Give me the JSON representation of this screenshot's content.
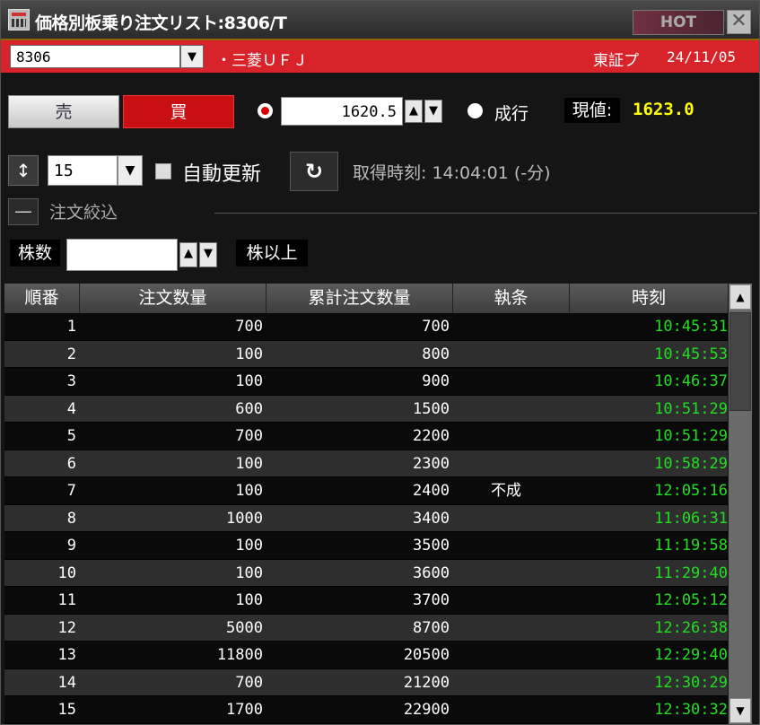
{
  "window": {
    "title": "価格別板乗り注文リスト:8306/T",
    "hot_label": "HOT",
    "close_label": "✕"
  },
  "symbol": {
    "code": "8306",
    "name": "・三菱ＵＦＪ",
    "market": "東証プ",
    "date": "24/11/05"
  },
  "order": {
    "sell_label": "売",
    "buy_label": "買",
    "price": "1620.5",
    "market_label": "成行",
    "current_label": "現値:",
    "current_value": "1623.0"
  },
  "controls": {
    "sort_icon": "↕",
    "row_count": "15",
    "auto_refresh_label": "自動更新",
    "refresh_icon": "↻",
    "fetch_time": "取得時刻: 14:04:01 (-分)",
    "collapse_icon": "—",
    "filter_title": "注文絞込",
    "shares_label": "株数",
    "shares_value": "",
    "shares_suffix": "株以上"
  },
  "table": {
    "headers": [
      "順番",
      "注文数量",
      "累計注文数量",
      "執条",
      "時刻"
    ],
    "rows": [
      {
        "no": "1",
        "qty": "700",
        "cum": "700",
        "cond": "",
        "time": "10:45:31"
      },
      {
        "no": "2",
        "qty": "100",
        "cum": "800",
        "cond": "",
        "time": "10:45:53"
      },
      {
        "no": "3",
        "qty": "100",
        "cum": "900",
        "cond": "",
        "time": "10:46:37"
      },
      {
        "no": "4",
        "qty": "600",
        "cum": "1500",
        "cond": "",
        "time": "10:51:29"
      },
      {
        "no": "5",
        "qty": "700",
        "cum": "2200",
        "cond": "",
        "time": "10:51:29"
      },
      {
        "no": "6",
        "qty": "100",
        "cum": "2300",
        "cond": "",
        "time": "10:58:29"
      },
      {
        "no": "7",
        "qty": "100",
        "cum": "2400",
        "cond": "不成",
        "time": "12:05:16"
      },
      {
        "no": "8",
        "qty": "1000",
        "cum": "3400",
        "cond": "",
        "time": "11:06:31"
      },
      {
        "no": "9",
        "qty": "100",
        "cum": "3500",
        "cond": "",
        "time": "11:19:58"
      },
      {
        "no": "10",
        "qty": "100",
        "cum": "3600",
        "cond": "",
        "time": "11:29:40"
      },
      {
        "no": "11",
        "qty": "100",
        "cum": "3700",
        "cond": "",
        "time": "12:05:12"
      },
      {
        "no": "12",
        "qty": "5000",
        "cum": "8700",
        "cond": "",
        "time": "12:26:38"
      },
      {
        "no": "13",
        "qty": "11800",
        "cum": "20500",
        "cond": "",
        "time": "12:29:40"
      },
      {
        "no": "14",
        "qty": "700",
        "cum": "21200",
        "cond": "",
        "time": "12:30:29"
      },
      {
        "no": "15",
        "qty": "1700",
        "cum": "22900",
        "cond": "",
        "time": "12:30:32"
      }
    ]
  },
  "colors": {
    "accent_red": "#d8232a",
    "price_yellow": "#ffff00",
    "time_green": "#22dd22"
  }
}
